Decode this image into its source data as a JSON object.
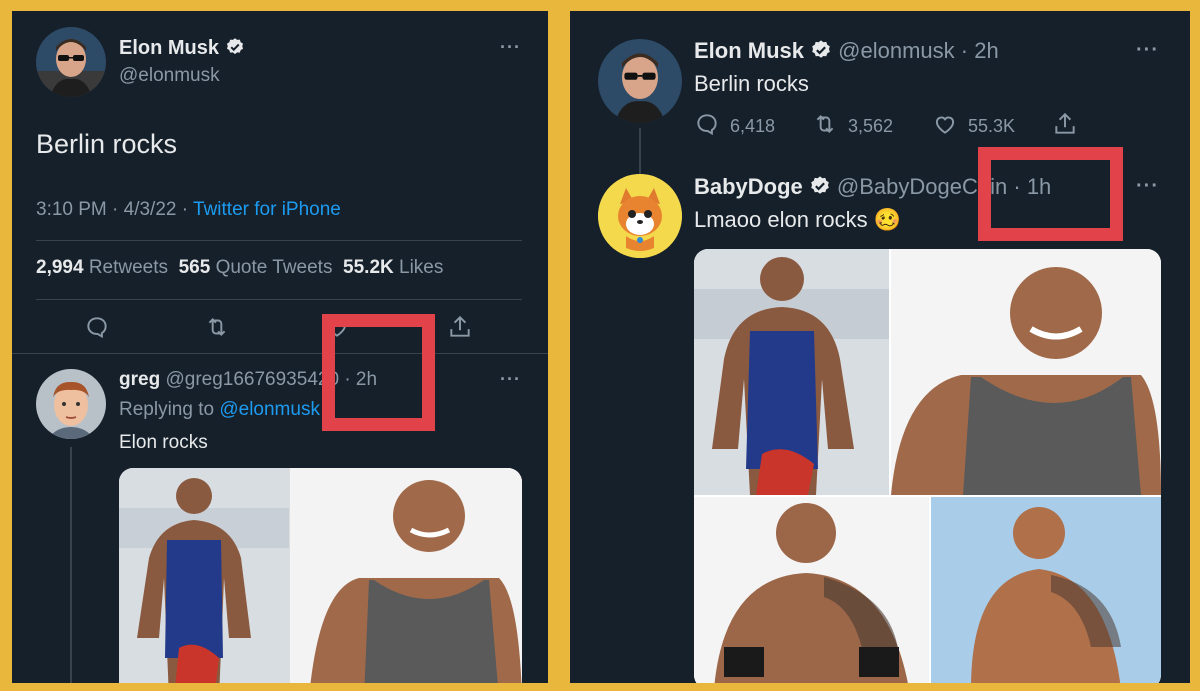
{
  "left": {
    "main_tweet": {
      "name": "Elon Musk",
      "handle": "@elonmusk",
      "text": "Berlin rocks",
      "meta_time": "3:10 PM · 4/3/22 · ",
      "meta_source": "Twitter for iPhone",
      "retweets_count": "2,994",
      "retweets_label": "Retweets",
      "quotes_count": "565",
      "quotes_label": "Quote Tweets",
      "likes_count": "55.2K",
      "likes_label": "Likes",
      "more": "···"
    },
    "reply": {
      "name": "greg",
      "handle": "@greg16676935420",
      "time": "· 2h",
      "replying_label": "Replying to ",
      "replying_handle": "@elonmusk",
      "text": "Elon rocks",
      "more": "···"
    }
  },
  "right": {
    "main_tweet": {
      "name": "Elon Musk",
      "handle": "@elonmusk",
      "time": "· 2h",
      "text": "Berlin rocks",
      "replies": "6,418",
      "retweets": "3,562",
      "likes": "55.3K",
      "more": "···"
    },
    "reply": {
      "name": "BabyDoge",
      "handle": "@BabyDogeCoin",
      "time": "· 1h",
      "text": "Lmaoo elon rocks 🥴",
      "more": "···"
    }
  },
  "colors": {
    "background_frame": "#e9b73b",
    "panel": "#15202b",
    "accent_link": "#1d9bf0",
    "highlight_box": "#e2434a",
    "muted_text": "#8b98a5"
  },
  "icons": [
    "verified-badge-icon",
    "reply-icon",
    "retweet-icon",
    "like-icon",
    "share-icon",
    "more-icon"
  ]
}
